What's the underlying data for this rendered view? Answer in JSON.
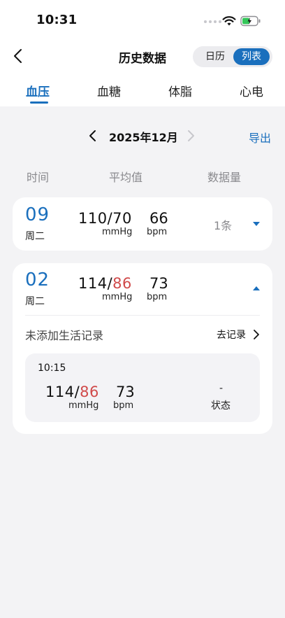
{
  "status_bar": {
    "time": "10:31"
  },
  "nav": {
    "title": "历史数据",
    "segment": [
      "日历",
      "列表"
    ],
    "selected_segment": "列表"
  },
  "tabs": [
    "血压",
    "血糖",
    "体脂",
    "心电"
  ],
  "active_tab": "血压",
  "month_nav": {
    "label": "2025年12月",
    "export_label": "导出"
  },
  "columns": {
    "time": "时间",
    "average": "平均值",
    "count": "数据量"
  },
  "entries": [
    {
      "day": "09",
      "weekday": "周二",
      "systolic": "110",
      "sep": "/",
      "diastolic": "70",
      "pulse": "66",
      "bp_unit": "mmHg",
      "pulse_unit": "bpm",
      "count": "1条",
      "expanded": false
    },
    {
      "day": "02",
      "weekday": "周二",
      "systolic": "114",
      "sep": "/",
      "diastolic": "86",
      "pulse": "73",
      "bp_unit": "mmHg",
      "pulse_unit": "bpm",
      "expanded": true,
      "life_record_label": "未添加生活记录",
      "go_record_label": "去记录",
      "records": [
        {
          "time": "10:15",
          "systolic": "114",
          "sep": "/",
          "diastolic": "86",
          "pulse": "73",
          "bp_unit": "mmHg",
          "pulse_unit": "bpm",
          "status_value": "-",
          "status_label": "状态"
        }
      ]
    }
  ],
  "colors": {
    "accent": "#1a6fbd",
    "high_value": "#d04a4a",
    "background": "#f3f3f5"
  }
}
